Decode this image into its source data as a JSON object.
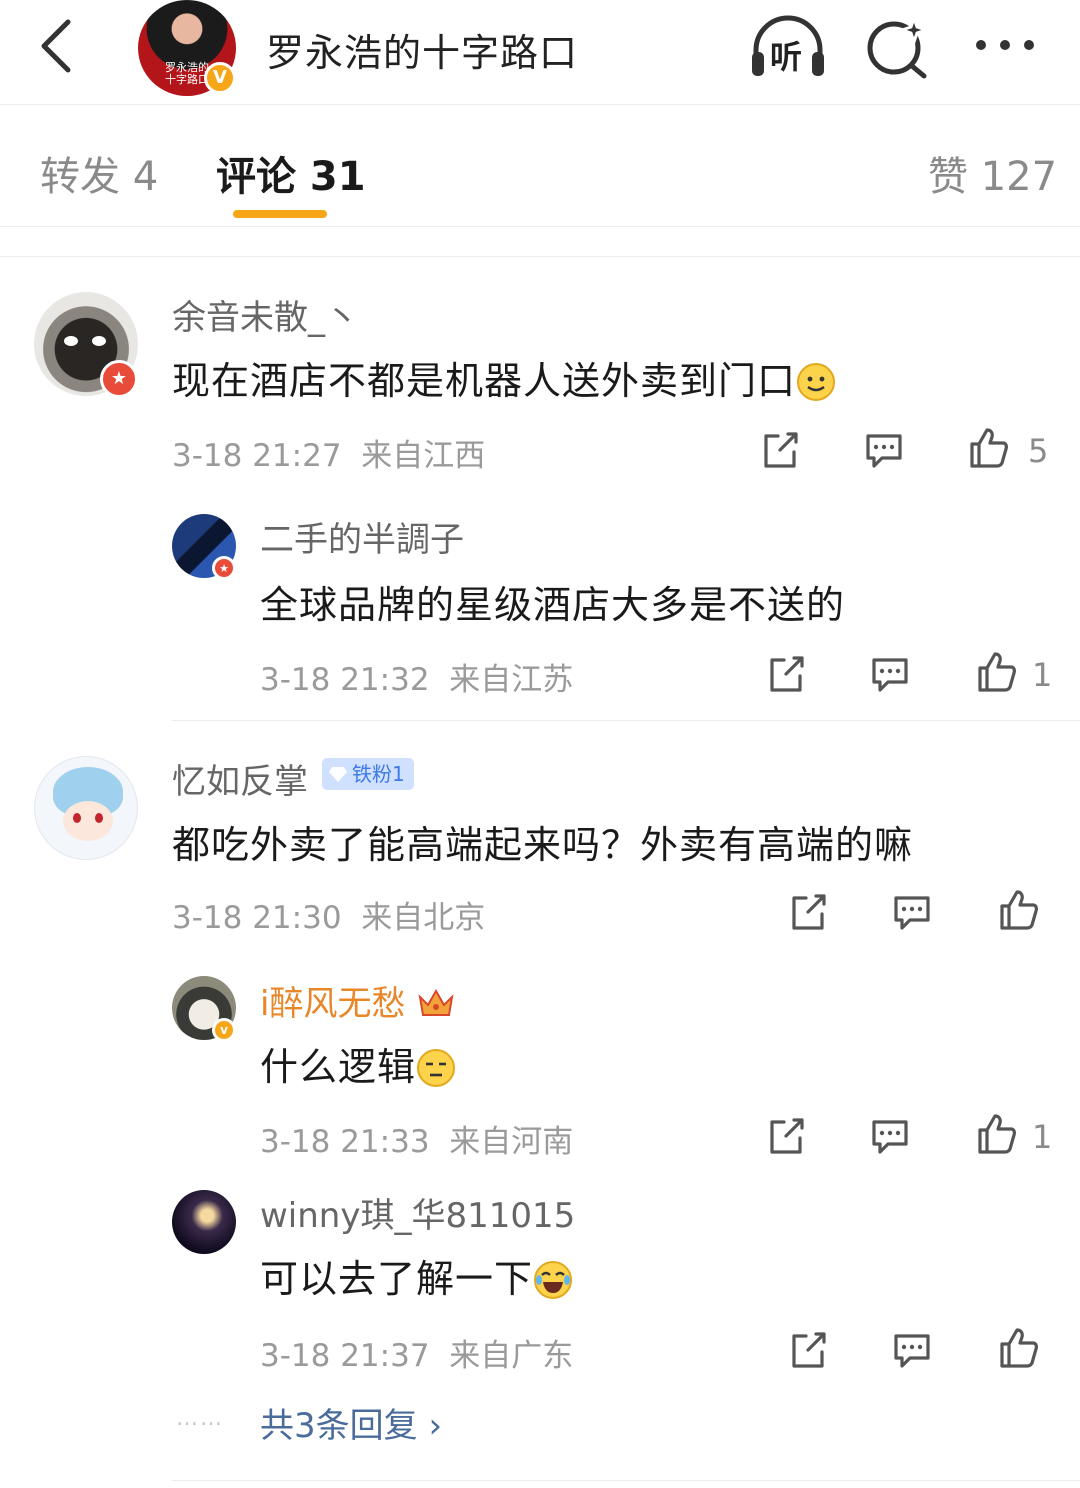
{
  "header": {
    "title": "罗永浩的十字路口",
    "avatar_caption": "罗永浩的十字路口",
    "verified_mark": "V",
    "listen_label": "听",
    "icons": [
      "back-icon",
      "headphones-icon",
      "search-sparkle-icon",
      "more-icon"
    ]
  },
  "tabs": {
    "repost": "转发 4",
    "comments": "评论 31",
    "likes": "赞 127"
  },
  "comments": [
    {
      "user": "余音未散_丶",
      "text": "现在酒店不都是机器人送外卖到门口",
      "time": "3-18 21:27",
      "location": "来自江西",
      "likes": "5",
      "replies": [
        {
          "user": "二手的半調子",
          "text": "全球品牌的星级酒店大多是不送的",
          "time": "3-18 21:32",
          "location": "来自江苏",
          "likes": "1"
        }
      ]
    },
    {
      "user": "忆如反掌",
      "fan_badge": "铁粉1",
      "text": "都吃外卖了能高端起来吗？外卖有高端的嘛",
      "time": "3-18 21:30",
      "location": "来自北京",
      "likes": "",
      "replies": [
        {
          "user": "i醉风无愁",
          "text": "什么逻辑",
          "time": "3-18 21:33",
          "location": "来自河南",
          "likes": "1"
        },
        {
          "user": "winny琪_华811015",
          "text": "可以去了解一下",
          "time": "3-18 21:37",
          "location": "来自广东",
          "likes": ""
        }
      ],
      "more_dots": "……",
      "more_replies": "共3条回复 ›"
    }
  ],
  "colors": {
    "accent": "#f7a618",
    "link": "#4a6c9c",
    "vip_name": "#e8862a",
    "badge_red": "#e94b3b"
  }
}
